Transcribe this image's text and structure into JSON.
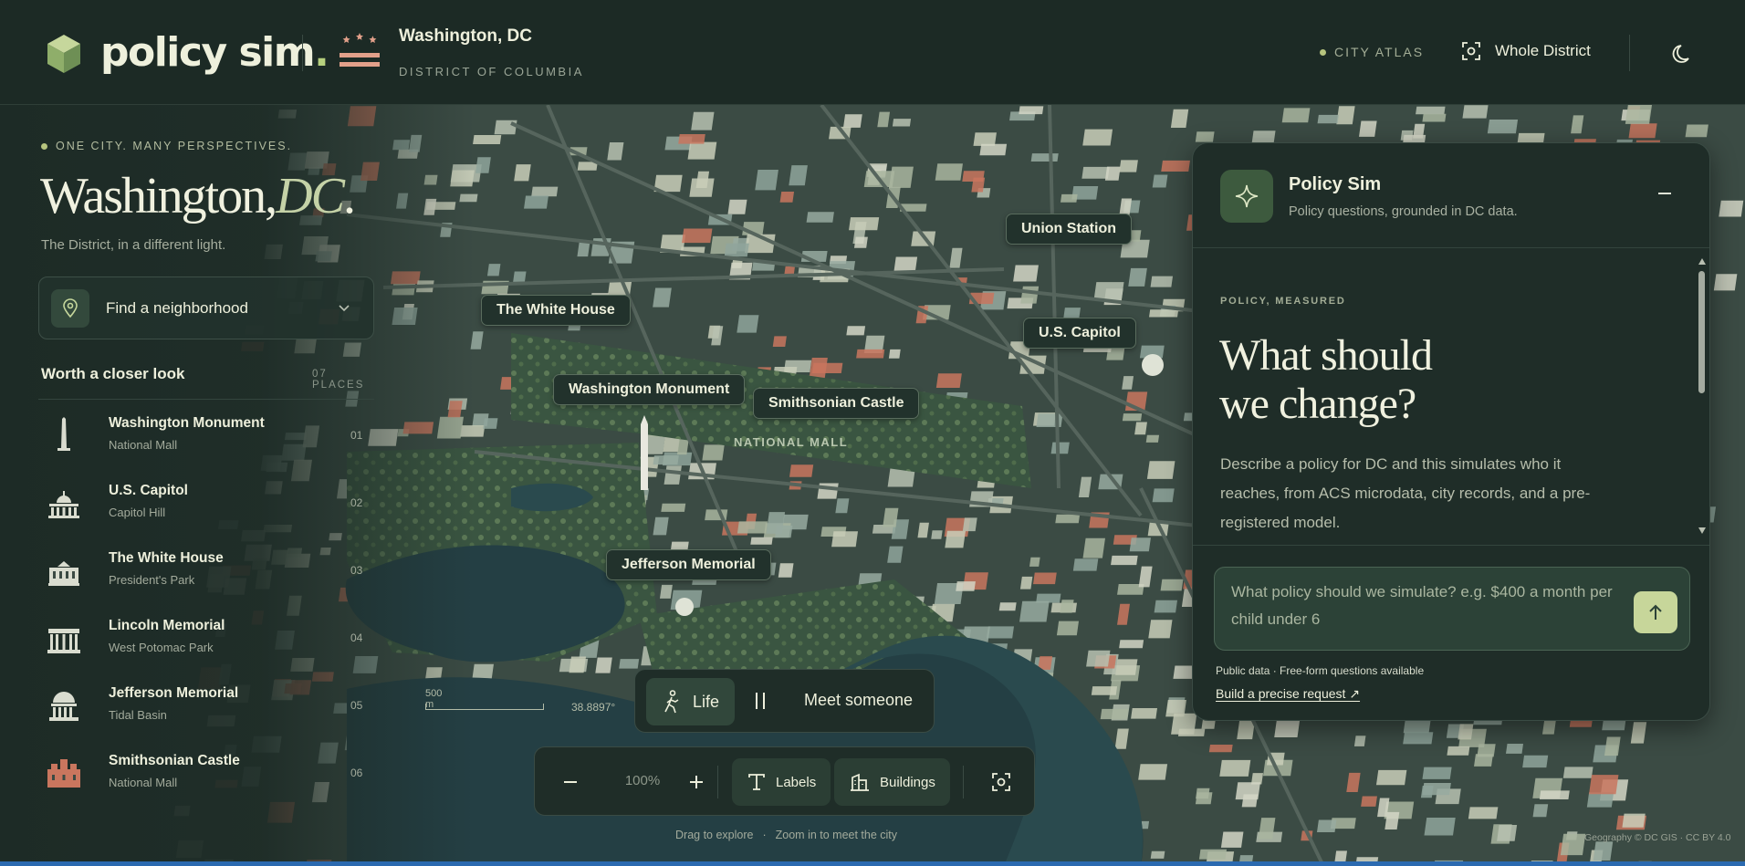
{
  "header": {
    "logo_text": "policy sim",
    "logo_dot": ".",
    "city_name": "Washington, DC",
    "city_sub": "DISTRICT OF COLUMBIA",
    "atlas_label": "CITY ATLAS",
    "whole_district_label": "Whole District"
  },
  "sidebar": {
    "tagline": "ONE CITY. MANY PERSPECTIVES.",
    "title_main": "Washington,",
    "title_accent": "DC",
    "title_period": ".",
    "subtitle": "The District, in a different light.",
    "neighborhood_label": "Find a neighborhood",
    "closer_title": "Worth a closer look",
    "closer_count": "07 PLACES",
    "places": [
      {
        "name": "Washington Monument",
        "area": "National Mall",
        "num": "01",
        "icon": "obelisk-icon"
      },
      {
        "name": "U.S. Capitol",
        "area": "Capitol Hill",
        "num": "02",
        "icon": "capitol-dome-icon"
      },
      {
        "name": "The White House",
        "area": "President's Park",
        "num": "03",
        "icon": "white-house-icon"
      },
      {
        "name": "Lincoln Memorial",
        "area": "West Potomac Park",
        "num": "04",
        "icon": "lincoln-memorial-icon"
      },
      {
        "name": "Jefferson Memorial",
        "area": "Tidal Basin",
        "num": "05",
        "icon": "jefferson-memorial-icon"
      },
      {
        "name": "Smithsonian Castle",
        "area": "National Mall",
        "num": "06",
        "icon": "castle-icon"
      }
    ]
  },
  "map": {
    "labels": {
      "union_station": "Union Station",
      "white_house": "The White House",
      "capitol": "U.S. Capitol",
      "monument": "Washington Monument",
      "smithsonian": "Smithsonian Castle",
      "jefferson": "Jefferson Memorial"
    },
    "national_mall": "NATIONAL MALL",
    "scale_label": "500 m",
    "coordinate": "38.8897°",
    "attribution": "Geography © DC GIS · CC BY 4.0"
  },
  "panel": {
    "title": "Policy Sim",
    "subtitle": "Policy questions, grounded in DC data.",
    "kicker": "POLICY, MEASURED",
    "heading_line1": "What should",
    "heading_line2": "we change?",
    "description": "Describe a policy for DC and this simulates who it reaches, from ACS microdata, city records, and a pre-registered model.",
    "input_placeholder": "What policy should we simulate? e.g. $400 a month per child under 6",
    "note": "Public data · Free-form questions available",
    "link": "Build a precise request ↗"
  },
  "controls": {
    "life_label": "Life",
    "meet_label": "Meet someone",
    "zoom_pct": "100%",
    "labels_toggle": "Labels",
    "buildings_toggle": "Buildings",
    "hint_left": "Drag to explore",
    "hint_sep": "·",
    "hint_right": "Zoom in to meet the city"
  },
  "colors": {
    "background": "#1c2a25",
    "panel": "#1f2d28",
    "accent": "#b6d07e",
    "send_button": "#c7d69a",
    "roof_red": "#c9765e",
    "water": "#243f44",
    "park": "#35503e"
  }
}
